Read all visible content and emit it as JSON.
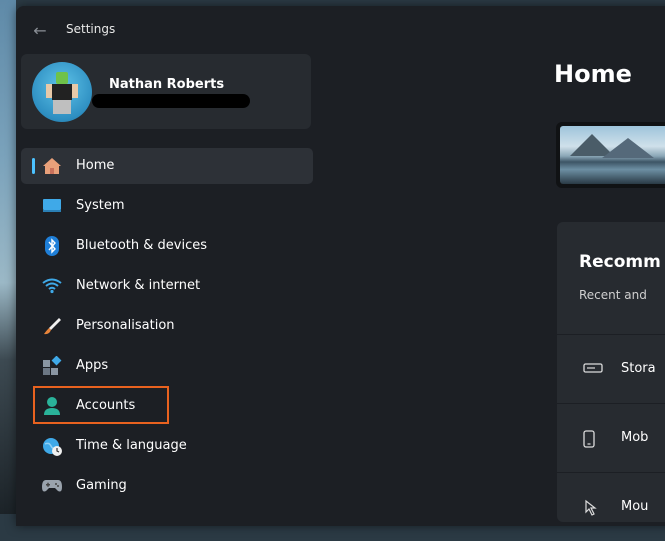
{
  "window": {
    "title": "Settings"
  },
  "profile": {
    "name": "Nathan Roberts"
  },
  "nav": {
    "items": [
      {
        "label": "Home",
        "icon": "home-icon",
        "selected": true
      },
      {
        "label": "System",
        "icon": "system-icon"
      },
      {
        "label": "Bluetooth & devices",
        "icon": "bluetooth-icon"
      },
      {
        "label": "Network & internet",
        "icon": "wifi-icon"
      },
      {
        "label": "Personalisation",
        "icon": "brush-icon"
      },
      {
        "label": "Apps",
        "icon": "apps-icon"
      },
      {
        "label": "Accounts",
        "icon": "account-icon",
        "highlighted": true
      },
      {
        "label": "Time & language",
        "icon": "globe-clock-icon"
      },
      {
        "label": "Gaming",
        "icon": "gamepad-icon"
      }
    ]
  },
  "main": {
    "title": "Home",
    "recommended": {
      "title": "Recomm",
      "subtitle": "Recent and",
      "rows": [
        {
          "label": "Stora",
          "icon": "storage-icon"
        },
        {
          "label": "Mob",
          "icon": "phone-icon"
        },
        {
          "label": "Mou",
          "icon": "mouse-icon"
        }
      ]
    }
  },
  "colors": {
    "accent": "#4cc2ff",
    "highlight_box": "#e8621f",
    "window_bg": "#1c1f24",
    "card_bg": "#272b30"
  }
}
